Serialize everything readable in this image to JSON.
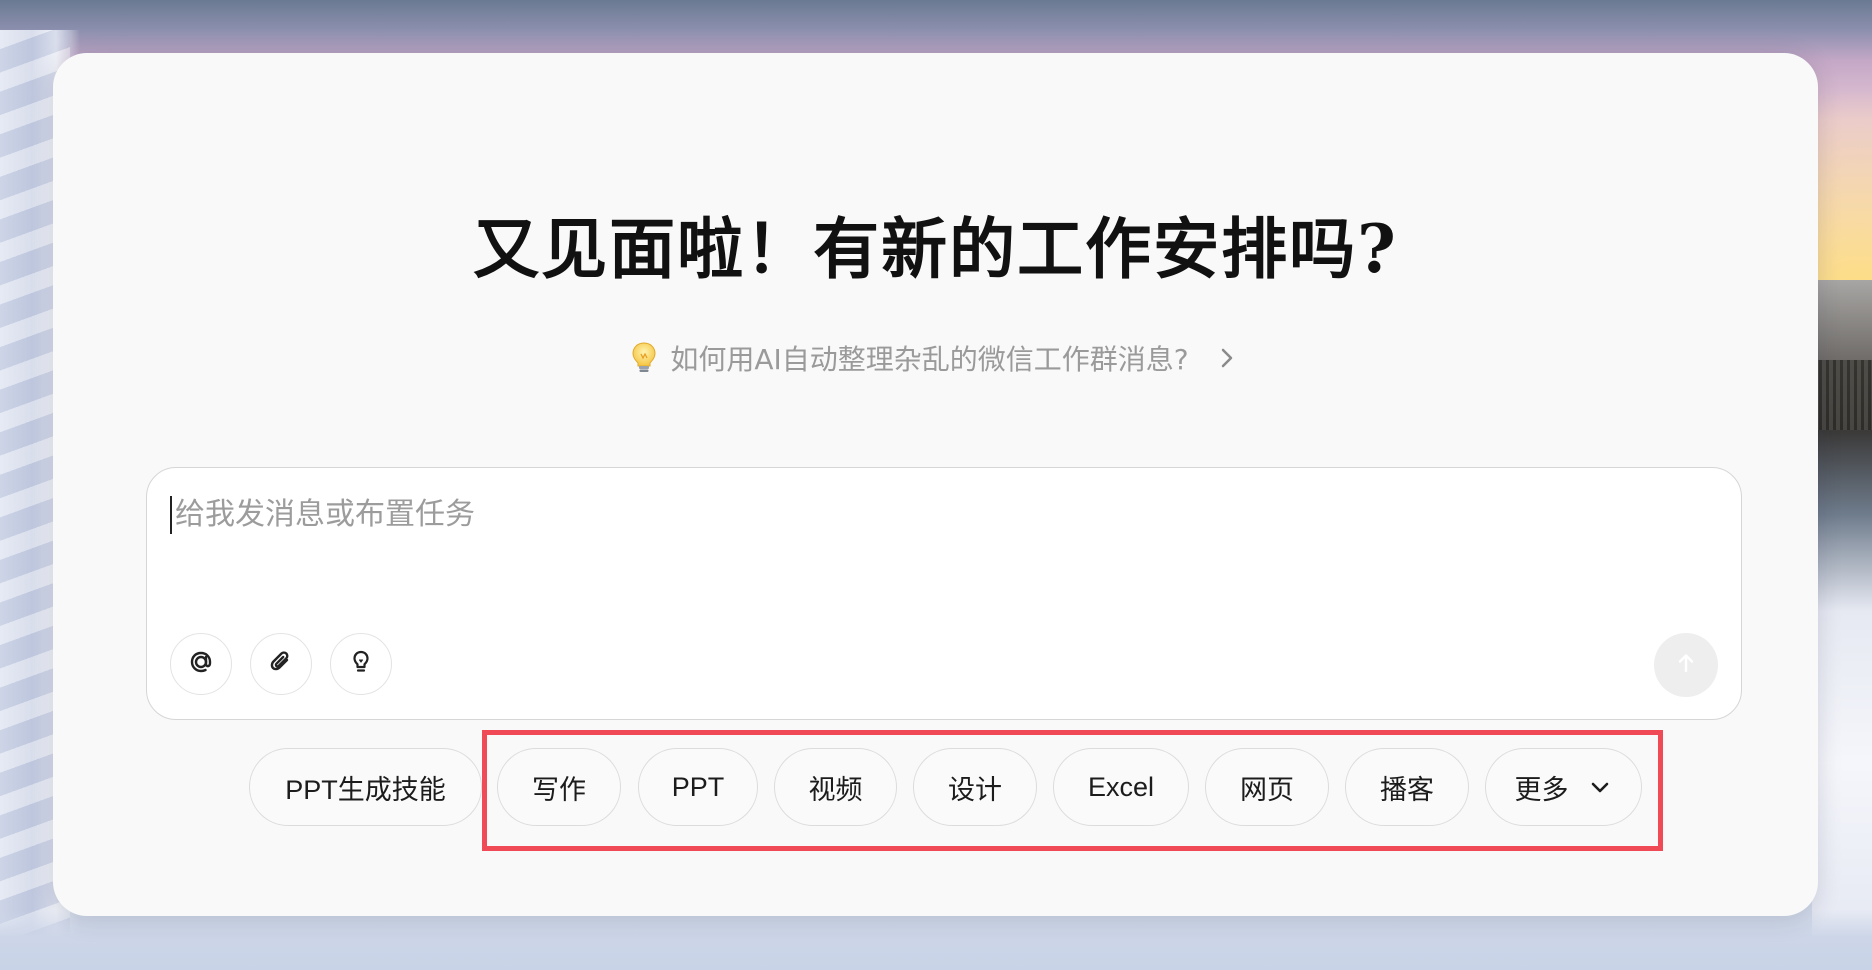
{
  "headline": "又见面啦！有新的工作安排吗?",
  "suggestion": {
    "text": "如何用AI自动整理杂乱的微信工作群消息?",
    "icon": "lightbulb-icon",
    "chevron": "chevron-right-icon"
  },
  "composer": {
    "placeholder": "给我发消息或布置任务",
    "tools": [
      "at-mention-icon",
      "attachment-icon",
      "lightbulb-icon"
    ],
    "send_icon": "arrow-up-icon"
  },
  "chips": [
    {
      "label": "PPT生成技能"
    },
    {
      "label": "写作"
    },
    {
      "label": "PPT"
    },
    {
      "label": "视频"
    },
    {
      "label": "设计"
    },
    {
      "label": "Excel"
    },
    {
      "label": "网页"
    },
    {
      "label": "播客"
    },
    {
      "label": "更多",
      "icon": "chevron-down-icon"
    }
  ],
  "colors": {
    "highlight_border": "#ef4a55",
    "card_background": "#f9f9f9"
  }
}
